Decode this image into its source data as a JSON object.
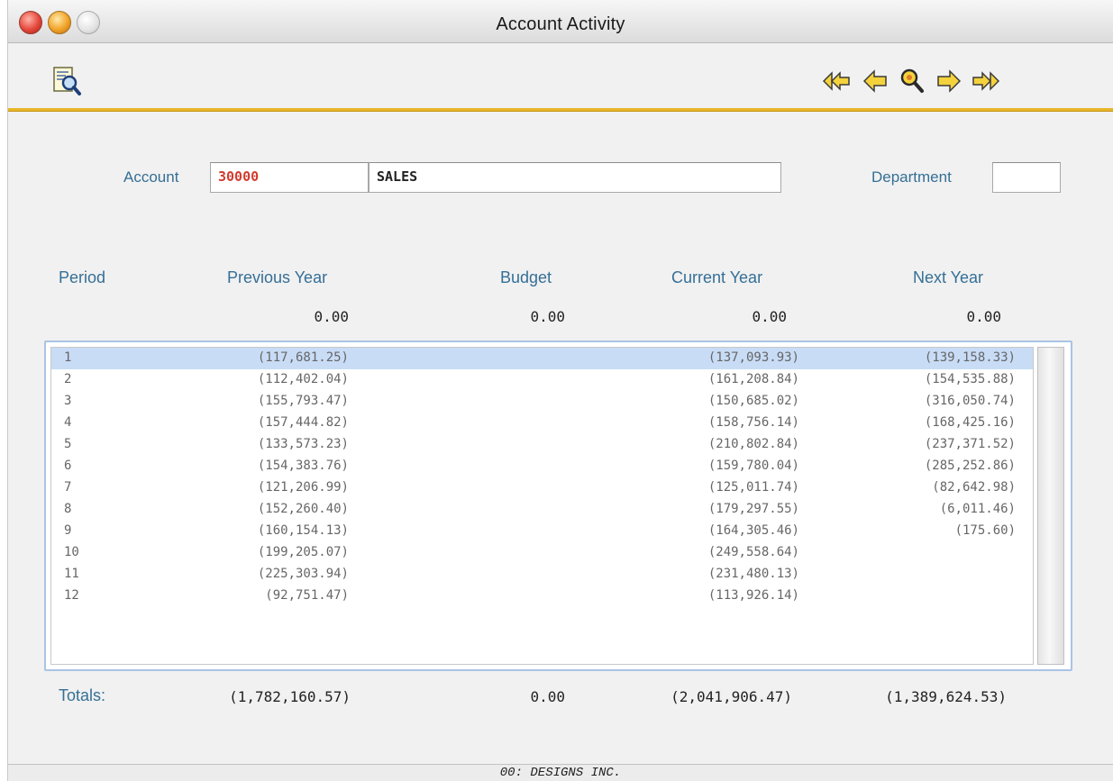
{
  "window": {
    "title": "Account Activity"
  },
  "toolbar": {
    "left_icon": "report-preview-icon",
    "nav_icons": [
      "first-record-icon",
      "previous-record-icon",
      "find-record-icon",
      "next-record-icon",
      "last-record-icon"
    ],
    "accent_color": "#e8b628"
  },
  "account": {
    "label": "Account",
    "code": "30000",
    "name": "SALES",
    "department_label": "Department",
    "department_value": ""
  },
  "columns": {
    "period": "Period",
    "previous_year": "Previous Year",
    "budget": "Budget",
    "current_year": "Current Year",
    "next_year": "Next Year"
  },
  "opening": {
    "previous_year": "0.00",
    "budget": "0.00",
    "current_year": "0.00",
    "next_year": "0.00"
  },
  "rows": [
    {
      "period": "1",
      "previous_year": "(117,681.25)",
      "budget": "",
      "current_year": "(137,093.93)",
      "next_year": "(139,158.33)"
    },
    {
      "period": "2",
      "previous_year": "(112,402.04)",
      "budget": "",
      "current_year": "(161,208.84)",
      "next_year": "(154,535.88)"
    },
    {
      "period": "3",
      "previous_year": "(155,793.47)",
      "budget": "",
      "current_year": "(150,685.02)",
      "next_year": "(316,050.74)"
    },
    {
      "period": "4",
      "previous_year": "(157,444.82)",
      "budget": "",
      "current_year": "(158,756.14)",
      "next_year": "(168,425.16)"
    },
    {
      "period": "5",
      "previous_year": "(133,573.23)",
      "budget": "",
      "current_year": "(210,802.84)",
      "next_year": "(237,371.52)"
    },
    {
      "period": "6",
      "previous_year": "(154,383.76)",
      "budget": "",
      "current_year": "(159,780.04)",
      "next_year": "(285,252.86)"
    },
    {
      "period": "7",
      "previous_year": "(121,206.99)",
      "budget": "",
      "current_year": "(125,011.74)",
      "next_year": "(82,642.98)"
    },
    {
      "period": "8",
      "previous_year": "(152,260.40)",
      "budget": "",
      "current_year": "(179,297.55)",
      "next_year": "(6,011.46)"
    },
    {
      "period": "9",
      "previous_year": "(160,154.13)",
      "budget": "",
      "current_year": "(164,305.46)",
      "next_year": "(175.60)"
    },
    {
      "period": "10",
      "previous_year": "(199,205.07)",
      "budget": "",
      "current_year": "(249,558.64)",
      "next_year": ""
    },
    {
      "period": "11",
      "previous_year": "(225,303.94)",
      "budget": "",
      "current_year": "(231,480.13)",
      "next_year": ""
    },
    {
      "period": "12",
      "previous_year": "(92,751.47)",
      "budget": "",
      "current_year": "(113,926.14)",
      "next_year": ""
    }
  ],
  "totals": {
    "label": "Totals:",
    "previous_year": "(1,782,160.57)",
    "budget": "0.00",
    "current_year": "(2,041,906.47)",
    "next_year": "(1,389,624.53)"
  },
  "status": {
    "company": "00: DESIGNS INC."
  }
}
